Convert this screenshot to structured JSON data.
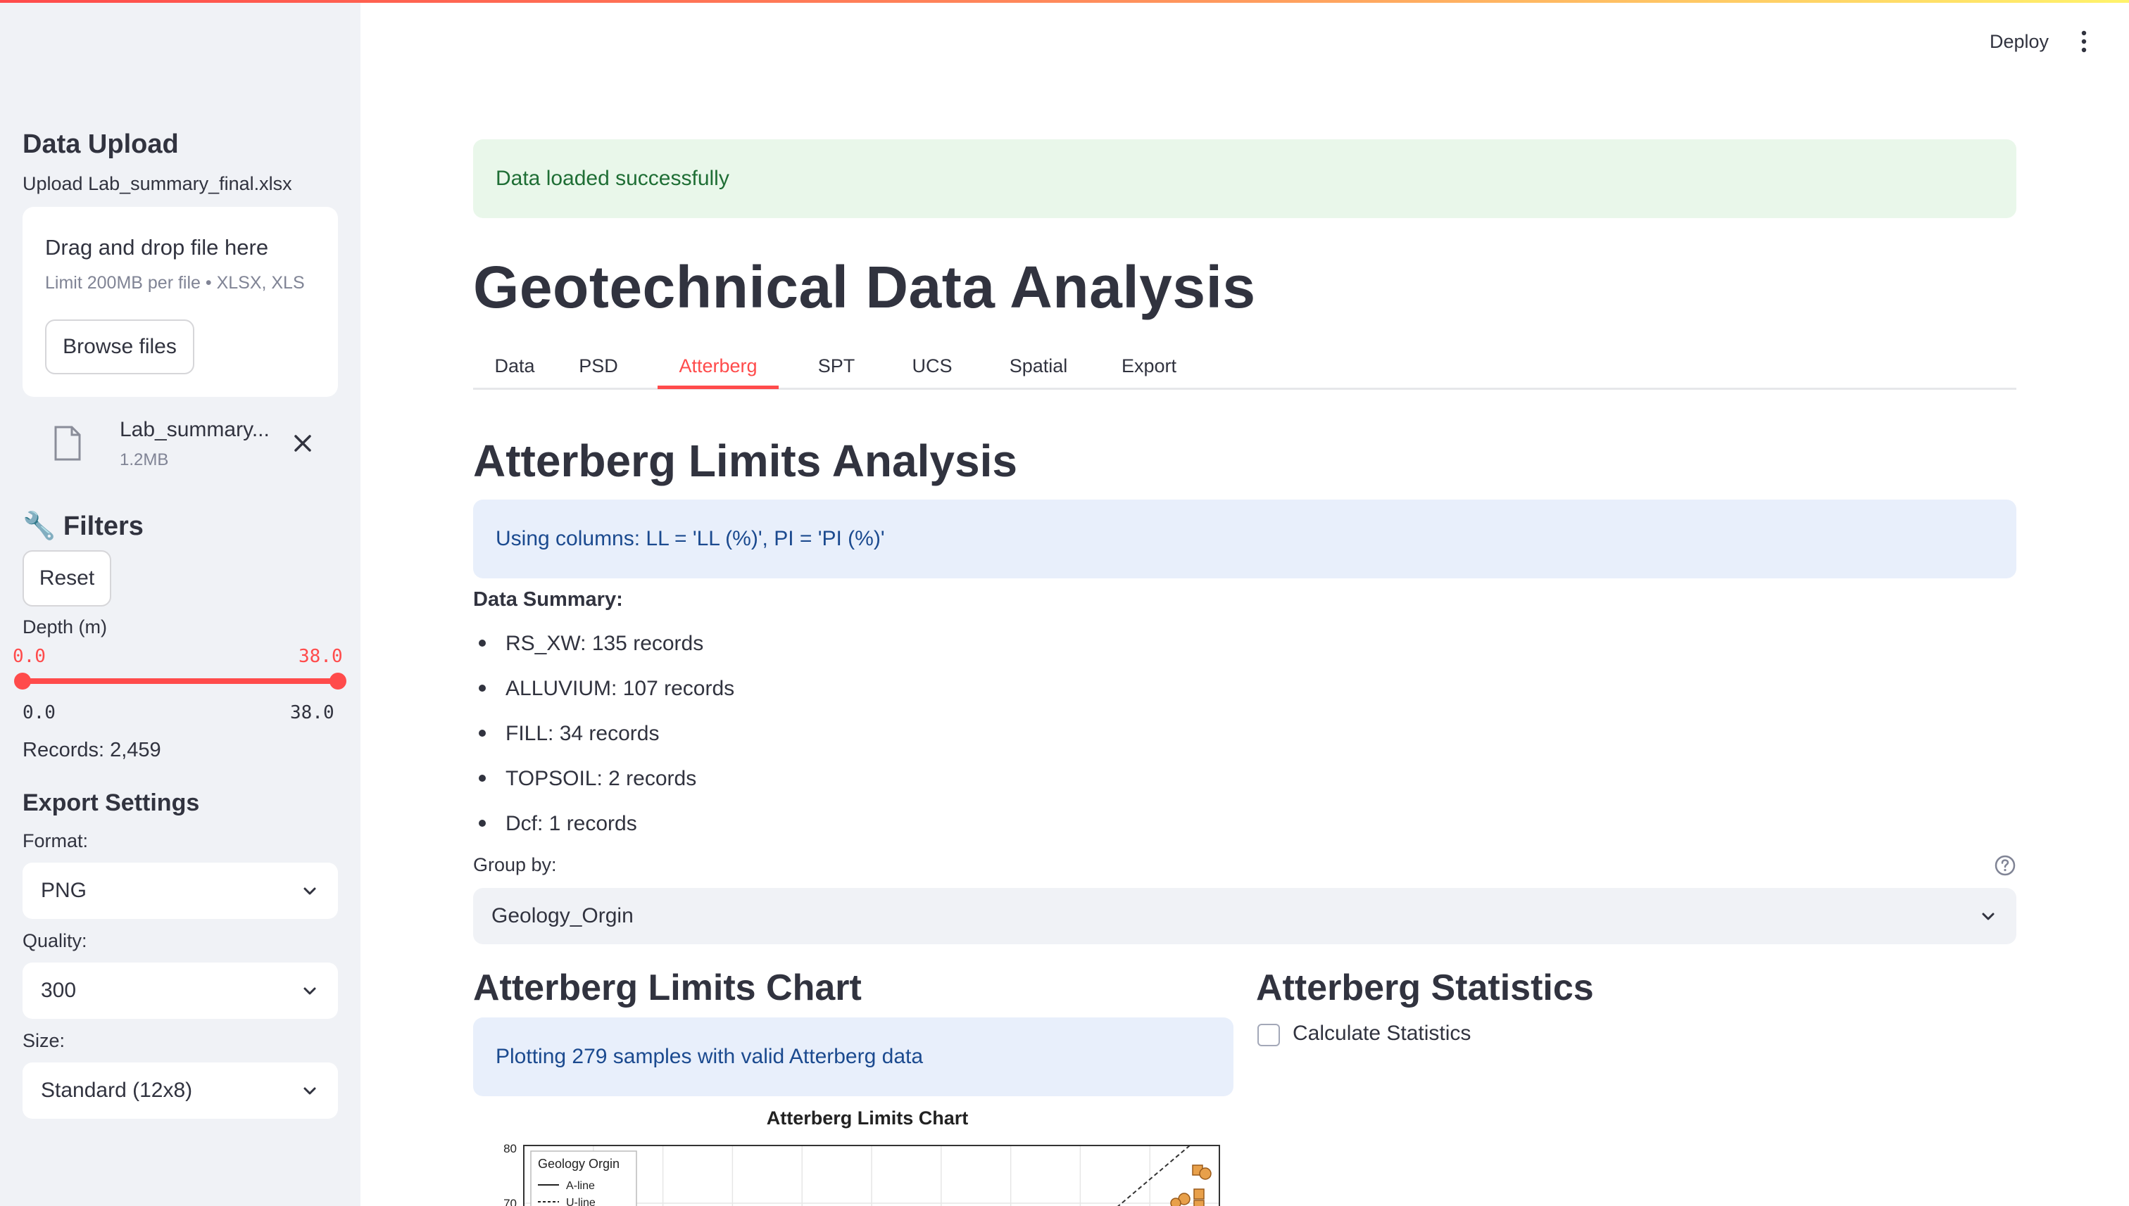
{
  "header": {
    "deploy_label": "Deploy",
    "menu_icon": "kebab-menu-icon"
  },
  "sidebar": {
    "upload_heading": "Data Upload",
    "upload_label": "Upload Lab_summary_final.xlsx",
    "dropzone": {
      "title": "Drag and drop file here",
      "subtitle": "Limit 200MB per file • XLSX, XLS",
      "browse_label": "Browse files"
    },
    "uploaded_file": {
      "name": "Lab_summary...",
      "size": "1.2MB"
    },
    "filters_heading": "🔧 Filters",
    "reset_label": "Reset",
    "depth_label": "Depth (m)",
    "depth": {
      "low": "0.0",
      "high": "38.0",
      "min": "0.0",
      "max": "38.0"
    },
    "records_text": "Records: 2,459",
    "export_heading": "Export Settings",
    "format_label": "Format:",
    "format_value": "PNG",
    "quality_label": "Quality:",
    "quality_value": "300",
    "size_label": "Size:",
    "size_value": "Standard (12x8)"
  },
  "main": {
    "success_message": "Data loaded successfully",
    "title": "Geotechnical Data Analysis",
    "tabs": [
      {
        "label": "Data"
      },
      {
        "label": "PSD"
      },
      {
        "label": "Atterberg",
        "active": true
      },
      {
        "label": "SPT"
      },
      {
        "label": "UCS"
      },
      {
        "label": "Spatial"
      },
      {
        "label": "Export"
      }
    ],
    "section_title": "Atterberg Limits Analysis",
    "columns_info": "Using columns: LL = 'LL (%)', PI = 'PI (%)'",
    "summary_label": "Data Summary:",
    "summary_items": [
      "RS_XW: 135 records",
      "ALLUVIUM: 107 records",
      "FILL: 34 records",
      "TOPSOIL: 2 records",
      "Dcf: 1 records"
    ],
    "group_by_label": "Group by:",
    "group_by_value": "Geology_Orgin",
    "chart_heading": "Atterberg Limits Chart",
    "plotting_info": "Plotting 279 samples with valid Atterberg data",
    "stats_heading": "Atterberg Statistics",
    "calc_stats_label": "Calculate Statistics"
  },
  "chart_data": {
    "type": "scatter",
    "title": "Atterberg Limits Chart",
    "y_ticks": [
      "80",
      "70"
    ],
    "legend": {
      "title": "Geology Orgin",
      "entries": [
        "A-line",
        "U-line"
      ],
      "placement": "top-left"
    },
    "grid": true,
    "points_visible_note": "",
    "series_color": "#e8a04a"
  },
  "colors": {
    "accent": "#ff4b4b",
    "sidebar_bg": "#f0f2f6",
    "success_bg": "#e9f7ea",
    "info_bg": "#e8effb"
  }
}
